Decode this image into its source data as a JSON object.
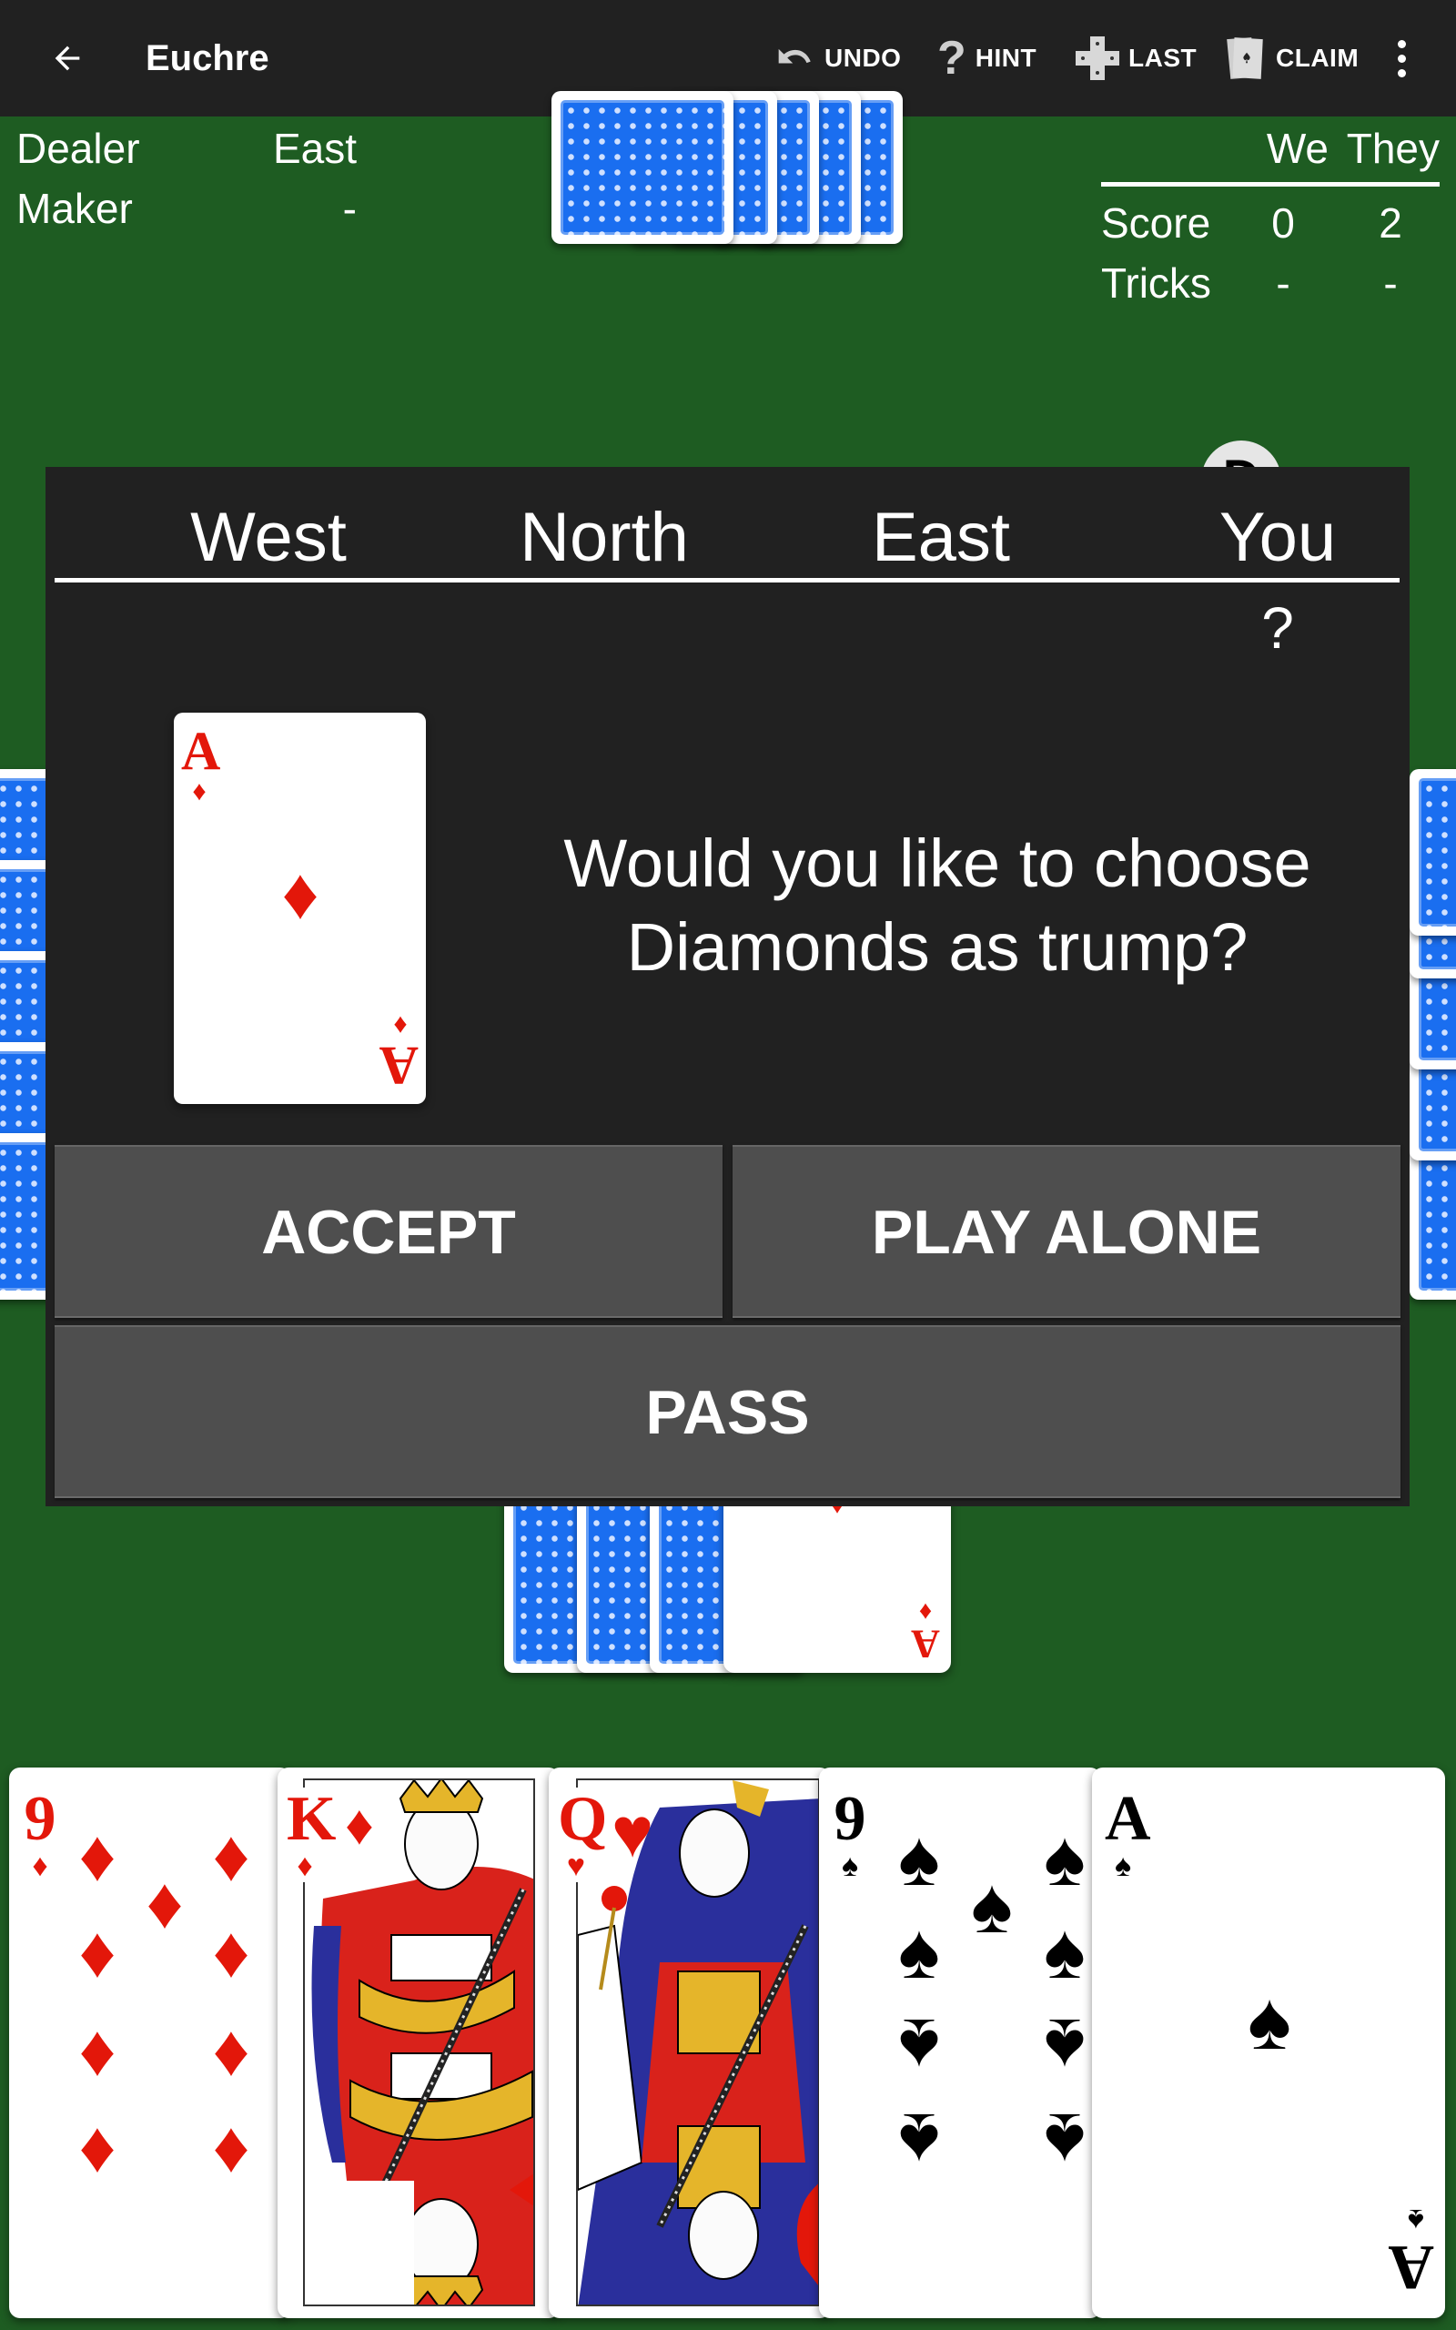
{
  "app": {
    "title": "Euchre",
    "back_icon": "arrow-left-icon"
  },
  "toolbar": {
    "undo_label": "UNDO",
    "hint_label": "HINT",
    "last_label": "LAST",
    "claim_label": "CLAIM",
    "undo_icon": "undo-icon",
    "hint_icon": "question-mark-icon",
    "last_icon": "last-trick-cards-icon",
    "claim_icon": "fanned-cards-icon",
    "more_icon": "more-vert-icon"
  },
  "info": {
    "dealer_label": "Dealer",
    "dealer_value": "East",
    "maker_label": "Maker",
    "maker_value": "-"
  },
  "score": {
    "col_we": "We",
    "col_they": "They",
    "rows": [
      {
        "label": "Score",
        "we": "0",
        "they": "2"
      },
      {
        "label": "Tricks",
        "we": "-",
        "they": "-"
      }
    ]
  },
  "dealer_chip": "D",
  "dialog": {
    "players": [
      "West",
      "North",
      "East",
      "You"
    ],
    "bids": [
      "",
      "",
      "",
      "?"
    ],
    "upcard": {
      "rank": "A",
      "suit": "♦",
      "color": "#e3170a"
    },
    "question": "Would you like to choose Diamonds as trump?",
    "accept_label": "ACCEPT",
    "play_alone_label": "PLAY ALONE",
    "pass_label": "PASS"
  },
  "kitty": {
    "facedown_count": 3,
    "upcard": {
      "rank": "A",
      "suit": "♦",
      "color": "#e3170a"
    }
  },
  "opponents": {
    "north_card_count": 5,
    "west_card_count": 5,
    "east_card_count": 5
  },
  "hand": [
    {
      "rank": "9",
      "suit": "♦",
      "color": "#e3170a"
    },
    {
      "rank": "K",
      "suit": "♦",
      "color": "#e3170a"
    },
    {
      "rank": "Q",
      "suit": "♥",
      "color": "#e3170a"
    },
    {
      "rank": "9",
      "suit": "♠",
      "color": "#000000"
    },
    {
      "rank": "A",
      "suit": "♠",
      "color": "#000000"
    }
  ],
  "colors": {
    "table_green": "#1e5c22",
    "appbar": "#212121",
    "dialog_bg": "#212121",
    "button_bg": "#4e4e4e",
    "card_back_blue": "#1a6ef0",
    "red_suit": "#e3170a"
  }
}
